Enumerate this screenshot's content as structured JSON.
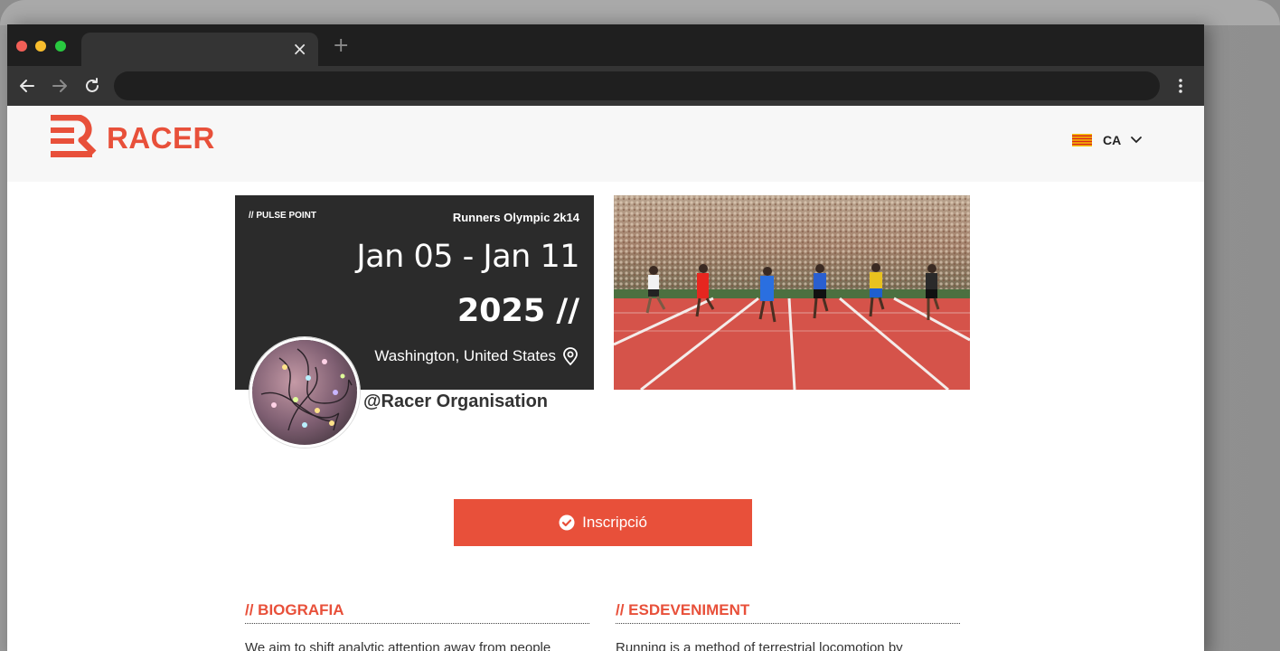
{
  "browser": {
    "tab_close": "×",
    "new_tab": "+"
  },
  "header": {
    "brand": "RACER",
    "language_code": "CA"
  },
  "event": {
    "pulse_label": "// PULSE POINT",
    "name": "Runners Olympic 2k14",
    "dates": "Jan 05 - Jan 11",
    "year": "2025 //",
    "location": "Washington, United States"
  },
  "organiser": {
    "name": "@Racer Organisation"
  },
  "register": {
    "label": "Inscripció"
  },
  "sections": {
    "bio_title": "// BIOGRAFIA",
    "bio_text": "We aim to shift analytic attention away from people",
    "event_title": "// ESDEVENIMENT",
    "event_text": "Running is a method of terrestrial locomotion by"
  },
  "colors": {
    "accent": "#e8503a",
    "card_bg": "#2b2b2b"
  },
  "icons": {
    "back": "arrow-left-icon",
    "forward": "arrow-right-icon",
    "reload": "reload-icon",
    "menu": "kebab-menu-icon",
    "location": "map-pin-icon",
    "register": "check-circle-icon"
  }
}
